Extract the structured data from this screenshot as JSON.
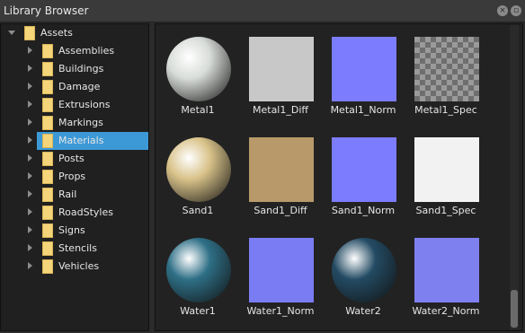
{
  "window": {
    "title": "Library Browser"
  },
  "tree": {
    "root": "Assets",
    "items": [
      {
        "label": "Assemblies"
      },
      {
        "label": "Buildings"
      },
      {
        "label": "Damage"
      },
      {
        "label": "Extrusions"
      },
      {
        "label": "Markings"
      },
      {
        "label": "Materials"
      },
      {
        "label": "Posts"
      },
      {
        "label": "Props"
      },
      {
        "label": "Rail"
      },
      {
        "label": "RoadStyles"
      },
      {
        "label": "Signs"
      },
      {
        "label": "Stencils"
      },
      {
        "label": "Vehicles"
      }
    ],
    "selected": "Materials"
  },
  "assets": [
    {
      "name": "Metal1",
      "kind": "sphere",
      "color": "#d8dcd8"
    },
    {
      "name": "Metal1_Diff",
      "kind": "texture",
      "color": "#c8c8c8"
    },
    {
      "name": "Metal1_Norm",
      "kind": "texture",
      "color": "#7c7cff"
    },
    {
      "name": "Metal1_Spec",
      "kind": "checker",
      "color": "#8a8a8a"
    },
    {
      "name": "Sand1",
      "kind": "sphere",
      "color": "#d9c38a"
    },
    {
      "name": "Sand1_Diff",
      "kind": "texture",
      "color": "#b89a6a"
    },
    {
      "name": "Sand1_Norm",
      "kind": "texture",
      "color": "#7c7cff"
    },
    {
      "name": "Sand1_Spec",
      "kind": "texture",
      "color": "#f2f2f2"
    },
    {
      "name": "Water1",
      "kind": "sphere",
      "color": "#2e6f86"
    },
    {
      "name": "Water1_Norm",
      "kind": "texture",
      "color": "#7a7cf4"
    },
    {
      "name": "Water2",
      "kind": "sphere",
      "color": "#234b63"
    },
    {
      "name": "Water2_Norm",
      "kind": "texture",
      "color": "#7f80f0"
    }
  ]
}
